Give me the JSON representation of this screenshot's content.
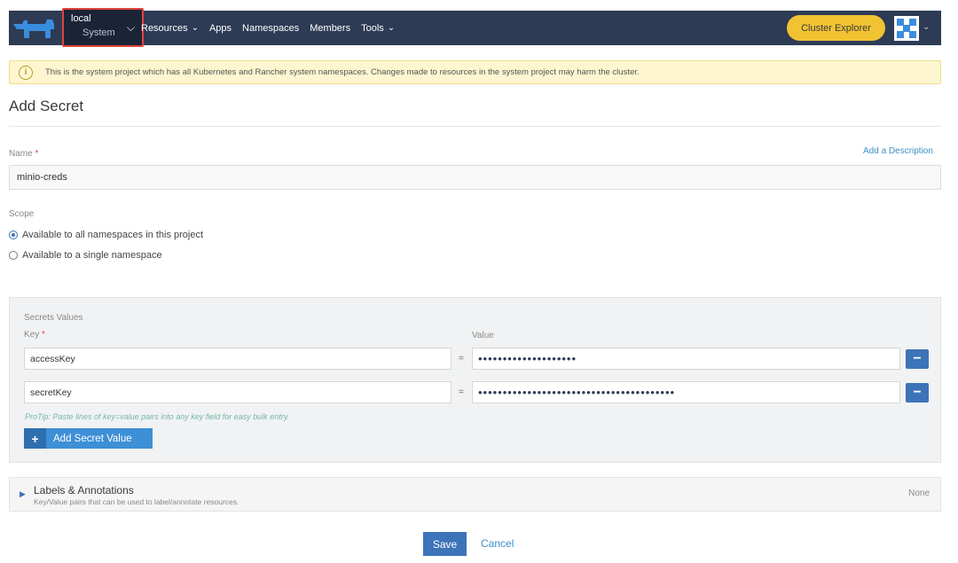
{
  "topbar": {
    "cluster": {
      "name": "local",
      "project": "System"
    },
    "nav": [
      {
        "label": "Resources",
        "dropdown": true
      },
      {
        "label": "Apps",
        "dropdown": false
      },
      {
        "label": "Namespaces",
        "dropdown": false
      },
      {
        "label": "Members",
        "dropdown": false
      },
      {
        "label": "Tools",
        "dropdown": true
      }
    ],
    "cluster_explorer_label": "Cluster Explorer",
    "icons": {
      "logo": "rancher-logo",
      "chevron": "chevron-down-icon",
      "avatar": "user-avatar-icon"
    }
  },
  "banner": {
    "text": "This is the system project which has all Kubernetes and Rancher system namespaces. Changes made to resources in the system project may harm the cluster.",
    "icon": "info-icon"
  },
  "page_title": "Add Secret",
  "name_field": {
    "label": "Name",
    "required_mark": "*",
    "value": "minio-creds",
    "add_description_label": "Add a Description"
  },
  "scope": {
    "label": "Scope",
    "options": [
      {
        "label": "Available to all namespaces in this project",
        "selected": true
      },
      {
        "label": "Available to a single namespace",
        "selected": false
      }
    ]
  },
  "secrets": {
    "section_label": "Secrets Values",
    "key_header": "Key",
    "required_mark": "*",
    "value_header": "Value",
    "equals": "=",
    "rows": [
      {
        "key": "accessKey",
        "masked_value": "••••••••••••••••••••"
      },
      {
        "key": "secretKey",
        "masked_value": "••••••••••••••••••••••••••••••••••••••••"
      }
    ],
    "protip": "ProTip: Paste lines of key=value pairs into any key field for easy bulk entry.",
    "add_value_label": "Add Secret Value"
  },
  "labels": {
    "title": "Labels & Annotations",
    "subtitle": "Key/Value pairs that can be used to label/annotate resources.",
    "status": "None"
  },
  "footer": {
    "save_label": "Save",
    "cancel_label": "Cancel"
  },
  "colors": {
    "nav_bg": "#2d3b55",
    "accent_blue": "#3d73b8",
    "explorer_yellow": "#f1c232",
    "highlight_red": "#e0443e"
  }
}
